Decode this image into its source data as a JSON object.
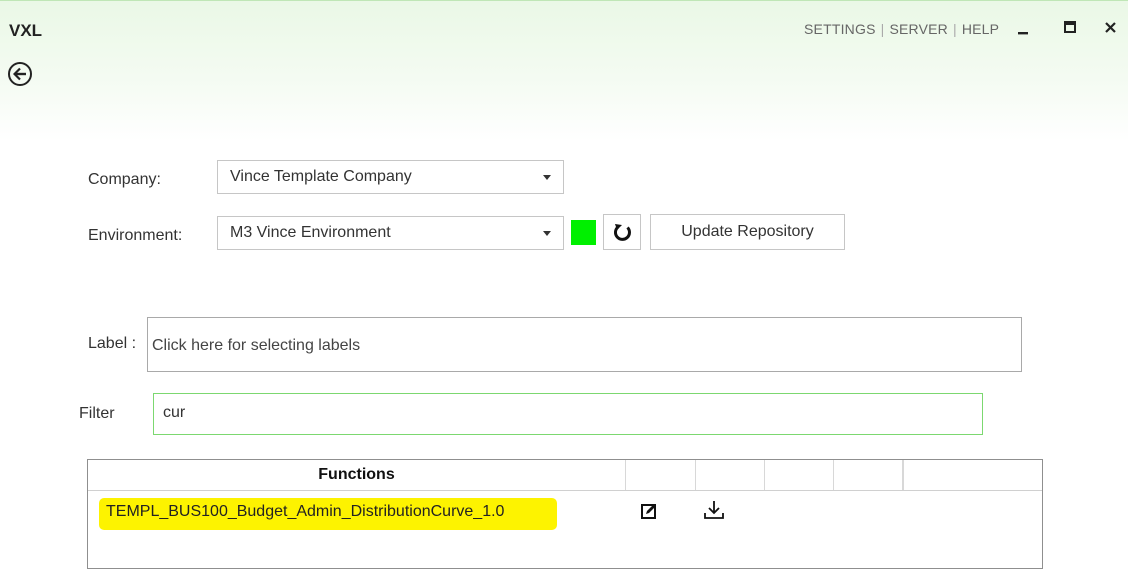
{
  "app": {
    "title": "VXL"
  },
  "top_menu": {
    "settings": "SETTINGS",
    "server": "SERVER",
    "help": "HELP",
    "separator": "|"
  },
  "window_controls": [
    "minimize-icon",
    "maximize-icon",
    "close-icon"
  ],
  "form": {
    "company_label": "Company:",
    "company_value": "Vince Template Company",
    "environment_label": "Environment:",
    "environment_value": "M3 Vince Environment",
    "environment_status_color": "#00f000",
    "update_button": "Update Repository",
    "label_label": "Label :",
    "label_placeholder": "Click here for selecting labels",
    "filter_label": "Filter",
    "filter_value": "cur"
  },
  "grid": {
    "header": "Functions",
    "rows": [
      {
        "name": "TEMPL_BUS100_Budget_Admin_DistributionCurve_1.0",
        "actions": [
          "edit-icon",
          "download-icon"
        ]
      }
    ]
  },
  "colors": {
    "accent_green": "#7cd870",
    "highlight": "#fdf300"
  }
}
